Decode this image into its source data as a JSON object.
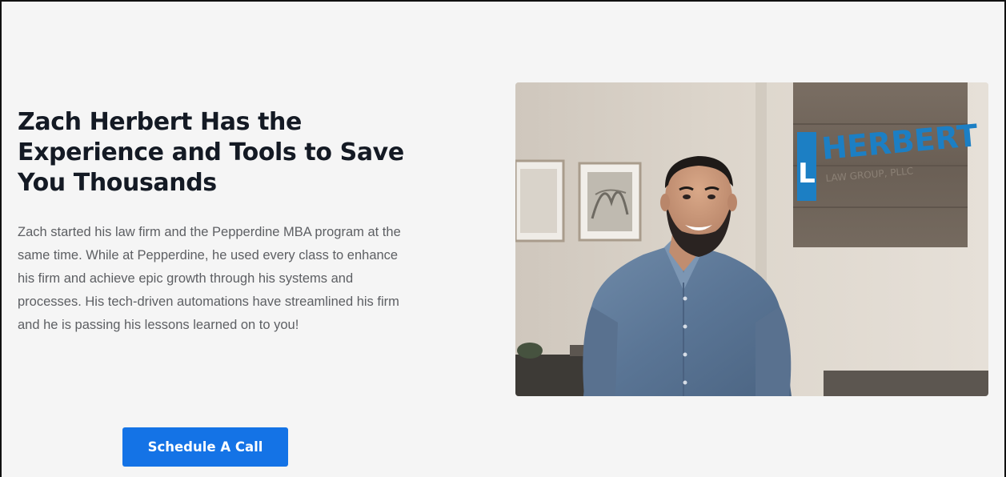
{
  "hero": {
    "headline": "Zach Herbert Has the Experience and Tools to Save You Thousands",
    "bio": "Zach started his law firm and the Pepperdine MBA program at the same time.  While at Pepperdine, he used every class to enhance his firm and achieve epic growth through his systems and processes.  His tech-driven automations have streamlined his firm and he is passing his lessons learned on to you!",
    "cta_label": "Schedule A Call"
  },
  "photo": {
    "sign_text": "HERBERT",
    "sign_subtext": "LAW GROUP, PLLC",
    "sign_logo": "L"
  },
  "colors": {
    "background": "#f5f5f5",
    "headline": "#141a24",
    "body_text": "#5d5f63",
    "button": "#1473e6",
    "button_text": "#ffffff",
    "sign_letters": "#1c7fc4"
  }
}
